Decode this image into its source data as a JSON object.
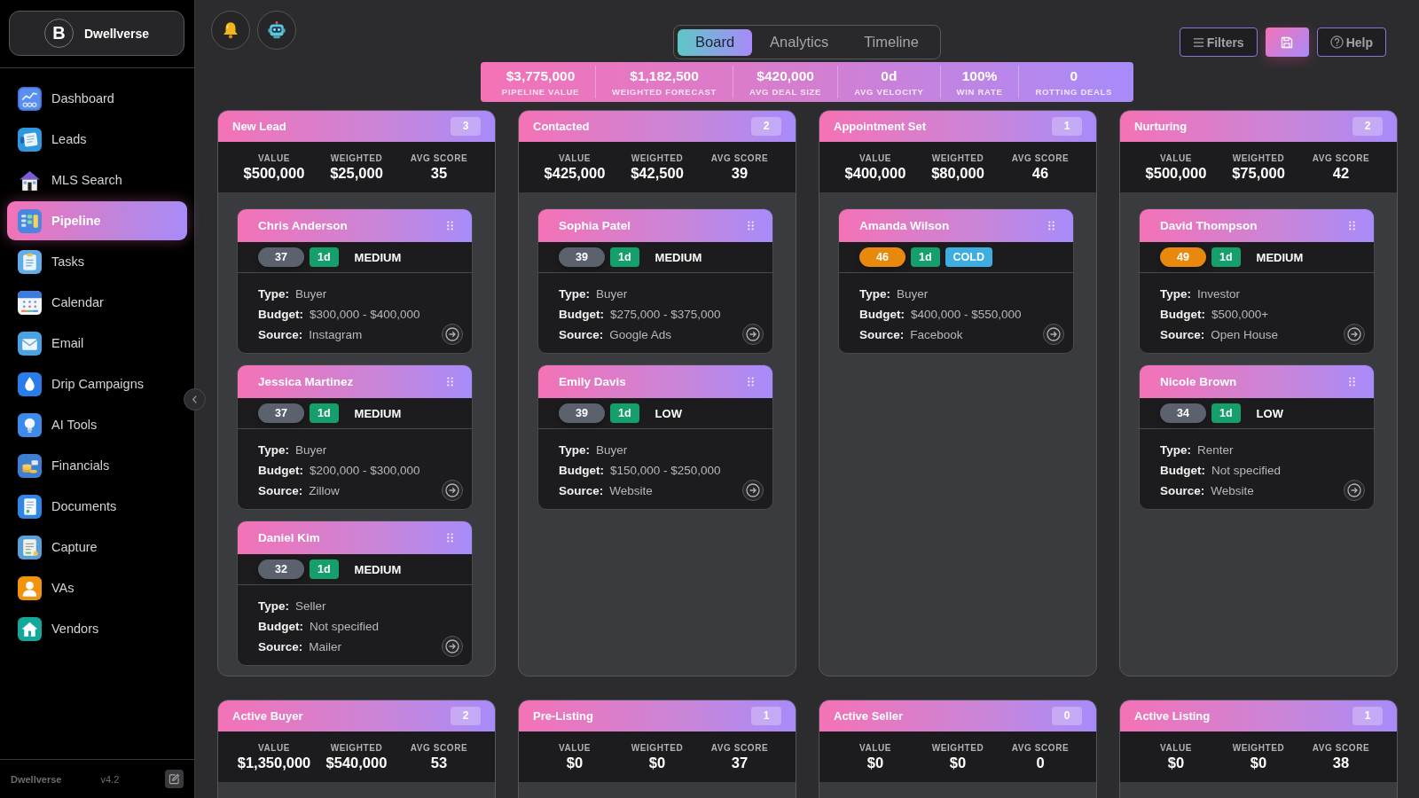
{
  "sidebar": {
    "brand": {
      "logo_letter": "B",
      "name": "Dwellverse"
    },
    "items": [
      {
        "label": "Dashboard",
        "selected": false
      },
      {
        "label": "Leads",
        "selected": false
      },
      {
        "label": "MLS Search",
        "selected": false
      },
      {
        "label": "Pipeline",
        "selected": true
      },
      {
        "label": "Tasks",
        "selected": false
      },
      {
        "label": "Calendar",
        "selected": false
      },
      {
        "label": "Email",
        "selected": false
      },
      {
        "label": "Drip Campaigns",
        "selected": false
      },
      {
        "label": "AI Tools",
        "selected": false
      },
      {
        "label": "Financials",
        "selected": false
      },
      {
        "label": "Documents",
        "selected": false
      },
      {
        "label": "Capture",
        "selected": false
      },
      {
        "label": "VAs",
        "selected": false
      },
      {
        "label": "Vendors",
        "selected": false
      }
    ],
    "footer": {
      "app_name": "Dwellverse",
      "version": "v4.2"
    }
  },
  "view_tabs": [
    {
      "label": "Board",
      "selected": true
    },
    {
      "label": "Analytics",
      "selected": false
    },
    {
      "label": "Timeline",
      "selected": false
    }
  ],
  "summary_stats": [
    {
      "value": "$3,775,000",
      "label": "PIPELINE VALUE"
    },
    {
      "value": "$1,182,500",
      "label": "WEIGHTED FORECAST"
    },
    {
      "value": "$420,000",
      "label": "AVG DEAL SIZE"
    },
    {
      "value": "0d",
      "label": "AVG VELOCITY"
    },
    {
      "value": "100%",
      "label": "WIN RATE"
    },
    {
      "value": "0",
      "label": "ROTTING DEALS"
    }
  ],
  "toolbar": {
    "filters_button": "Filters",
    "help_button": "Help"
  },
  "stages": [
    {
      "title": "New Lead",
      "count": "3",
      "stats": [
        {
          "label": "VALUE",
          "value": "$500,000"
        },
        {
          "label": "WEIGHTED",
          "value": "$25,000"
        },
        {
          "label": "AVG SCORE",
          "value": "35"
        }
      ],
      "cards": [
        {
          "name": "Chris Anderson",
          "badges": [
            {
              "text": "37",
              "kind": "score",
              "color": "#5b626e"
            },
            {
              "text": "1d",
              "kind": "age",
              "color": "#159f6b"
            },
            {
              "text": "MEDIUM",
              "kind": "priority"
            }
          ],
          "details": [
            {
              "label": "Type:",
              "value": "Buyer"
            },
            {
              "label": "Budget:",
              "value": "$300,000 - $400,000"
            },
            {
              "label": "Source:",
              "value": "Instagram"
            }
          ]
        },
        {
          "name": "Jessica Martinez",
          "badges": [
            {
              "text": "37",
              "kind": "score",
              "color": "#5b626e"
            },
            {
              "text": "1d",
              "kind": "age",
              "color": "#159f6b"
            },
            {
              "text": "MEDIUM",
              "kind": "priority"
            }
          ],
          "details": [
            {
              "label": "Type:",
              "value": "Buyer"
            },
            {
              "label": "Budget:",
              "value": "$200,000 - $300,000"
            },
            {
              "label": "Source:",
              "value": "Zillow"
            }
          ]
        },
        {
          "name": "Daniel Kim",
          "badges": [
            {
              "text": "32",
              "kind": "score",
              "color": "#5b626e"
            },
            {
              "text": "1d",
              "kind": "age",
              "color": "#159f6b"
            },
            {
              "text": "MEDIUM",
              "kind": "priority"
            }
          ],
          "details": [
            {
              "label": "Type:",
              "value": "Seller"
            },
            {
              "label": "Budget:",
              "value": "Not specified"
            },
            {
              "label": "Source:",
              "value": "Mailer"
            }
          ]
        }
      ]
    },
    {
      "title": "Contacted",
      "count": "2",
      "stats": [
        {
          "label": "VALUE",
          "value": "$425,000"
        },
        {
          "label": "WEIGHTED",
          "value": "$42,500"
        },
        {
          "label": "AVG SCORE",
          "value": "39"
        }
      ],
      "cards": [
        {
          "name": "Sophia Patel",
          "badges": [
            {
              "text": "39",
              "kind": "score",
              "color": "#5b626e"
            },
            {
              "text": "1d",
              "kind": "age",
              "color": "#159f6b"
            },
            {
              "text": "MEDIUM",
              "kind": "priority"
            }
          ],
          "details": [
            {
              "label": "Type:",
              "value": "Buyer"
            },
            {
              "label": "Budget:",
              "value": "$275,000 - $375,000"
            },
            {
              "label": "Source:",
              "value": "Google Ads"
            }
          ]
        },
        {
          "name": "Emily Davis",
          "badges": [
            {
              "text": "39",
              "kind": "score",
              "color": "#5b626e"
            },
            {
              "text": "1d",
              "kind": "age",
              "color": "#159f6b"
            },
            {
              "text": "LOW",
              "kind": "priority"
            }
          ],
          "details": [
            {
              "label": "Type:",
              "value": "Buyer"
            },
            {
              "label": "Budget:",
              "value": "$150,000 - $250,000"
            },
            {
              "label": "Source:",
              "value": "Website"
            }
          ]
        }
      ]
    },
    {
      "title": "Appointment Set",
      "count": "1",
      "stats": [
        {
          "label": "VALUE",
          "value": "$400,000"
        },
        {
          "label": "WEIGHTED",
          "value": "$80,000"
        },
        {
          "label": "AVG SCORE",
          "value": "46"
        }
      ],
      "cards": [
        {
          "name": "Amanda Wilson",
          "badges": [
            {
              "text": "46",
              "kind": "score",
              "color": "#e8890e"
            },
            {
              "text": "1d",
              "kind": "age",
              "color": "#159f6b"
            },
            {
              "text": "COLD",
              "kind": "temperature",
              "color": "#3dade2"
            }
          ],
          "details": [
            {
              "label": "Type:",
              "value": "Buyer"
            },
            {
              "label": "Budget:",
              "value": "$400,000 - $550,000"
            },
            {
              "label": "Source:",
              "value": "Facebook"
            }
          ]
        }
      ]
    },
    {
      "title": "Nurturing",
      "count": "2",
      "stats": [
        {
          "label": "VALUE",
          "value": "$500,000"
        },
        {
          "label": "WEIGHTED",
          "value": "$75,000"
        },
        {
          "label": "AVG SCORE",
          "value": "42"
        }
      ],
      "cards": [
        {
          "name": "David Thompson",
          "badges": [
            {
              "text": "49",
              "kind": "score",
              "color": "#e8890e"
            },
            {
              "text": "1d",
              "kind": "age",
              "color": "#159f6b"
            },
            {
              "text": "MEDIUM",
              "kind": "priority"
            }
          ],
          "details": [
            {
              "label": "Type:",
              "value": "Investor"
            },
            {
              "label": "Budget:",
              "value": "$500,000+"
            },
            {
              "label": "Source:",
              "value": "Open House"
            }
          ]
        },
        {
          "name": "Nicole Brown",
          "badges": [
            {
              "text": "34",
              "kind": "score",
              "color": "#5b626e"
            },
            {
              "text": "1d",
              "kind": "age",
              "color": "#159f6b"
            },
            {
              "text": "LOW",
              "kind": "priority"
            }
          ],
          "details": [
            {
              "label": "Type:",
              "value": "Renter"
            },
            {
              "label": "Budget:",
              "value": "Not specified"
            },
            {
              "label": "Source:",
              "value": "Website"
            }
          ]
        }
      ]
    },
    {
      "title": "Active Buyer",
      "count": "2",
      "stats": [
        {
          "label": "VALUE",
          "value": "$1,350,000"
        },
        {
          "label": "WEIGHTED",
          "value": "$540,000"
        },
        {
          "label": "AVG SCORE",
          "value": "53"
        }
      ]
    },
    {
      "title": "Pre-Listing",
      "count": "1",
      "stats": [
        {
          "label": "VALUE",
          "value": "$0"
        },
        {
          "label": "WEIGHTED",
          "value": "$0"
        },
        {
          "label": "AVG SCORE",
          "value": "37"
        }
      ]
    },
    {
      "title": "Active Seller",
      "count": "0",
      "stats": [
        {
          "label": "VALUE",
          "value": "$0"
        },
        {
          "label": "WEIGHTED",
          "value": "$0"
        },
        {
          "label": "AVG SCORE",
          "value": "0"
        }
      ]
    },
    {
      "title": "Active Listing",
      "count": "1",
      "stats": [
        {
          "label": "VALUE",
          "value": "$0"
        },
        {
          "label": "WEIGHTED",
          "value": "$0"
        },
        {
          "label": "AVG SCORE",
          "value": "38"
        }
      ]
    }
  ]
}
